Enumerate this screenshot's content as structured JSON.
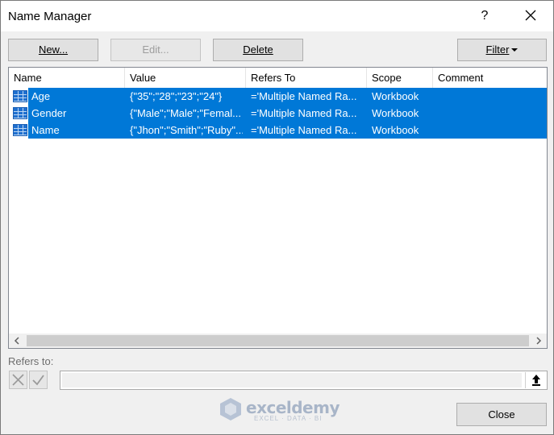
{
  "window": {
    "title": "Name Manager",
    "help_label": "?"
  },
  "toolbar": {
    "new_label": "New...",
    "edit_label": "Edit...",
    "delete_label": "Delete",
    "filter_label": "Filter"
  },
  "table": {
    "columns": [
      "Name",
      "Value",
      "Refers To",
      "Scope",
      "Comment"
    ],
    "rows": [
      {
        "name": "Age",
        "value": "{\"35\";\"28\";\"23\";\"24\"}",
        "refers_to": "='Multiple Named Ra...",
        "scope": "Workbook",
        "comment": ""
      },
      {
        "name": "Gender",
        "value": "{\"Male\";\"Male\";\"Femal...",
        "refers_to": "='Multiple Named Ra...",
        "scope": "Workbook",
        "comment": ""
      },
      {
        "name": "Name",
        "value": "{\"Jhon\";\"Smith\";\"Ruby\"...",
        "refers_to": "='Multiple Named Ra...",
        "scope": "Workbook",
        "comment": ""
      }
    ],
    "selection_color": "#0078d7"
  },
  "refers": {
    "label": "Refers to:",
    "value": ""
  },
  "footer": {
    "close_label": "Close"
  },
  "watermark": {
    "brand": "exceldemy",
    "tagline": "EXCEL · DATA · BI"
  },
  "icons": {
    "close": "close-icon",
    "help": "help-icon",
    "dropdown": "caret-down-icon",
    "named_range": "named-range-table-icon",
    "cancel": "cancel-x-icon",
    "confirm": "checkmark-icon",
    "collapse": "collapse-dialog-icon",
    "scroll_left": "chevron-left-icon",
    "scroll_right": "chevron-right-icon"
  }
}
